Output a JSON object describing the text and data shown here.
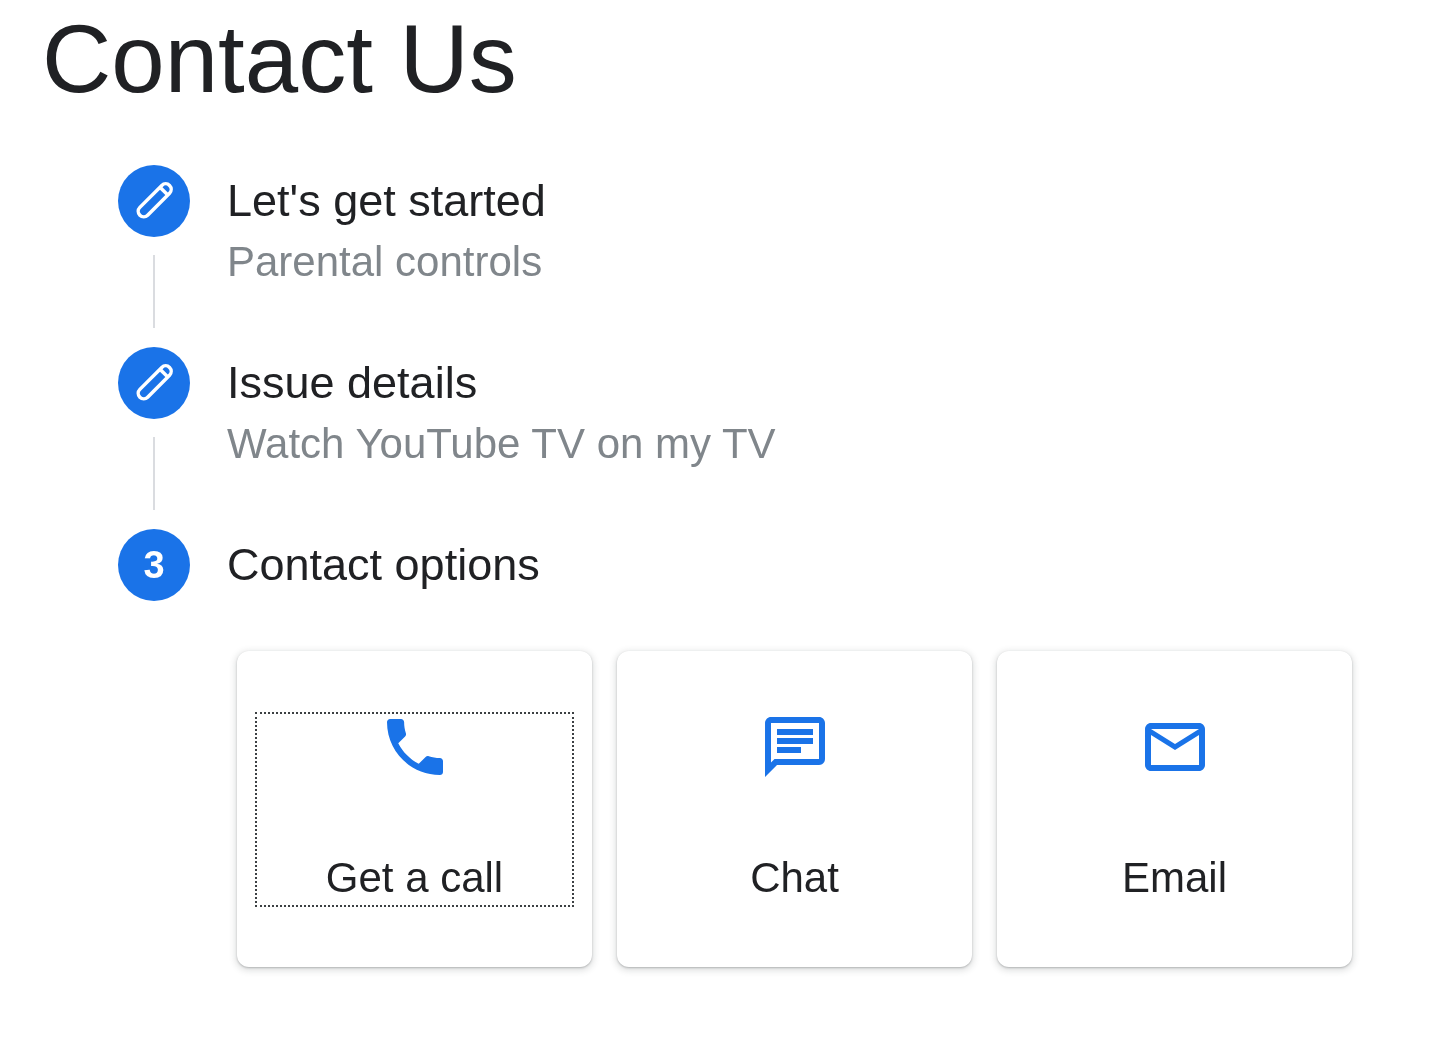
{
  "page_title": "Contact Us",
  "steps": [
    {
      "kind": "completed",
      "title": "Let's get started",
      "subtitle": "Parental controls"
    },
    {
      "kind": "completed",
      "title": "Issue details",
      "subtitle": "Watch YouTube TV on my TV"
    },
    {
      "kind": "current",
      "number": "3",
      "title": "Contact options"
    }
  ],
  "contact_options": [
    {
      "kind": "phone",
      "label": "Get a call",
      "focused": true
    },
    {
      "kind": "chat",
      "label": "Chat",
      "focused": false
    },
    {
      "kind": "email",
      "label": "Email",
      "focused": false
    }
  ]
}
